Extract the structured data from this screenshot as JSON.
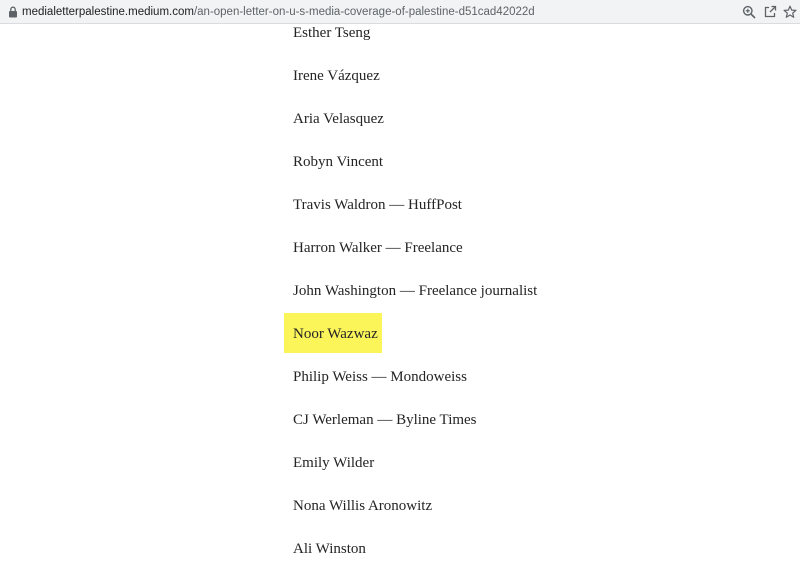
{
  "browser": {
    "url_host": "medialetterpalestine.medium.com",
    "url_path": "/an-open-letter-on-u-s-media-coverage-of-palestine-d51cad42022d",
    "icons": [
      "lock-icon",
      "zoom-icon",
      "share-icon",
      "star-icon"
    ]
  },
  "signatories": [
    "Esther Tseng",
    "Irene Vázquez",
    "Aria Velasquez",
    "Robyn Vincent",
    "Travis Waldron — HuffPost",
    "Harron Walker — Freelance",
    "John Washington — Freelance journalist",
    "Noor Wazwaz",
    "Philip Weiss — Mondoweiss",
    "CJ Werleman — Byline Times",
    "Emily Wilder",
    "Nona Willis Aronowitz",
    "Ali Winston"
  ],
  "highlighted_signatory": "Noor Wazwaz",
  "colors": {
    "highlight": "#fbf55a",
    "text": "#242424",
    "address_bar_bg": "#f1f3f4"
  }
}
